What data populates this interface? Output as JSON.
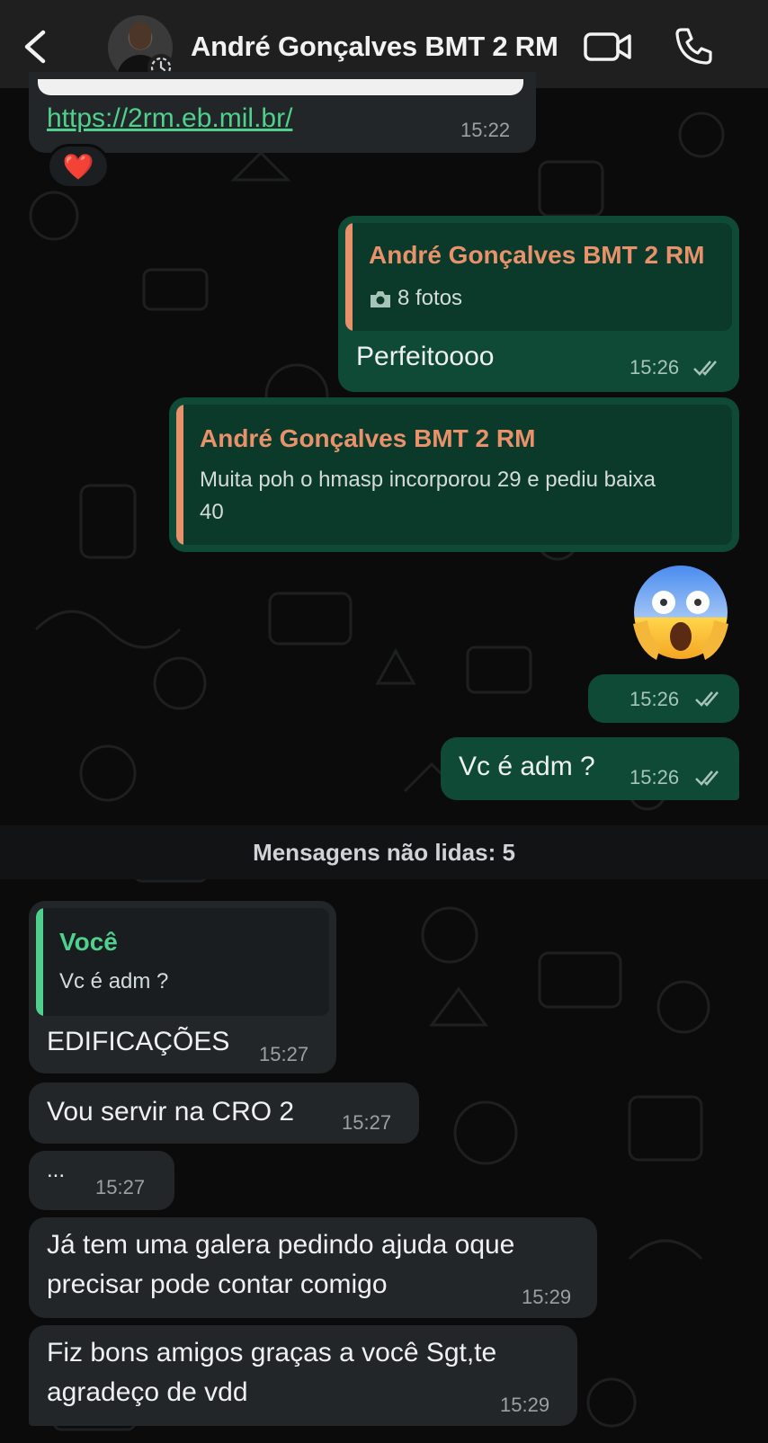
{
  "header": {
    "contact_name": "André Gonçalves BMT 2 RM",
    "back_icon": "chevron-left-icon",
    "video_icon": "video-camera-icon",
    "call_icon": "phone-icon",
    "avatar_badge_icon": "disappearing-timer-icon"
  },
  "messages": {
    "m1": {
      "link": "https://2rm.eb.mil.br/",
      "time": "15:22",
      "reaction": "❤️"
    },
    "m2": {
      "quote_name": "André Gonçalves BMT 2 RM",
      "quote_text": "8 fotos",
      "quote_icon": "camera-icon",
      "text": "Perfeitoooo",
      "time": "15:26"
    },
    "m3": {
      "quote_name": "André Gonçalves BMT 2 RM",
      "quote_line1": "Muita poh o hmasp incorporou 29 e pediu baixa",
      "quote_line2": "40"
    },
    "m4": {
      "emoji": "😱",
      "time": "15:26"
    },
    "m5": {
      "text": "Vc é adm ?",
      "time": "15:26"
    },
    "unread": "Mensagens não lidas: 5",
    "m6": {
      "quote_name": "Você",
      "quote_text": "Vc é adm ?",
      "text": "EDIFICAÇÕES",
      "time": "15:27"
    },
    "m7": {
      "text": "Vou servir na CRO 2",
      "time": "15:27"
    },
    "m8": {
      "text": "...",
      "time": "15:27"
    },
    "m9": {
      "line1": "Já tem uma galera pedindo ajuda oque",
      "line2": "precisar pode contar comigo",
      "time": "15:29"
    },
    "m10": {
      "line1": "Fiz bons amigos graças a você Sgt,te",
      "line2": "agradeço de vdd",
      "time": "15:29"
    }
  },
  "colors": {
    "outgoing_bubble": "#0e4a36",
    "incoming_bubble": "#222629",
    "quote_orange": "#e8916b",
    "quote_green": "#4fd08c",
    "link": "#4fd08c"
  }
}
